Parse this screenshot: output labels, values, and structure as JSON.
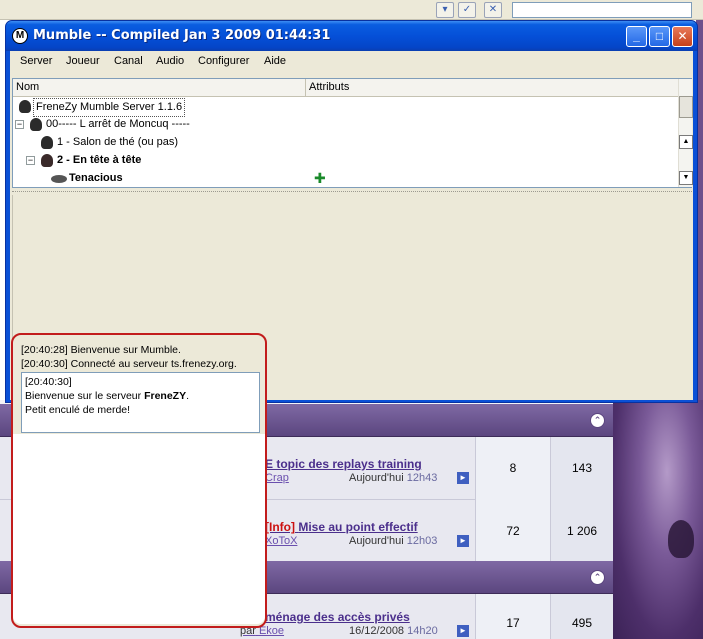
{
  "mumble": {
    "title": "Mumble -- Compiled Jan  3 2009 01:44:31",
    "window_controls": {
      "minimize": "_",
      "maximize": "□",
      "close": "✕"
    },
    "menu": [
      "Server",
      "Joueur",
      "Canal",
      "Audio",
      "Configurer",
      "Aide"
    ],
    "tree": {
      "columns": [
        "Nom",
        "Attributs"
      ],
      "rows": [
        {
          "label": "FreneZy Mumble Server 1.1.6",
          "type": "server",
          "expander": "",
          "bold": false
        },
        {
          "label": "00----- L arrêt de Moncuq -----",
          "type": "channel",
          "expander": "−",
          "bold": false
        },
        {
          "label": "1 - Salon de thé (ou pas)",
          "type": "channel",
          "expander": "",
          "bold": false
        },
        {
          "label": "2 - En tête à tête",
          "type": "channel",
          "expander": "−",
          "bold": true
        },
        {
          "label": "Tenacious",
          "type": "user",
          "expander": "",
          "bold": true,
          "attribute_icon": "authenticated-icon"
        }
      ]
    },
    "chat": {
      "log": [
        "[20:40:28] Bienvenue sur Mumble.",
        "[20:40:30] Connecté au serveur ts.frenezy.org."
      ],
      "message": {
        "time": "[20:40:30]",
        "line1_prefix": "Bienvenue sur le serveur ",
        "line1_server": "FreneZY",
        "line1_suffix": ".",
        "line2": "Petit enculé de merde!"
      }
    }
  },
  "forum": {
    "rows": [
      {
        "tag": "",
        "title": "E topic des replays training",
        "author": "Crap",
        "date": "Aujourd'hui",
        "time": "12h43",
        "replies": "8",
        "views": "143"
      },
      {
        "tag": "[Info]",
        "title": "Mise au point effectif",
        "author": "XoToX",
        "date": "Aujourd'hui",
        "time": "12h03",
        "replies": "72",
        "views": "1 206"
      },
      {
        "tag": "",
        "title": "ménage des accès privés",
        "author": "Ekoe",
        "date": "16/12/2008",
        "time": "14h20",
        "replies": "17",
        "views": "495",
        "author_prefix": "par"
      }
    ]
  },
  "colors": {
    "xp_blue": "#0a50d6",
    "highlight_red": "#c21c1c",
    "forum_purple": "#5b467f"
  }
}
